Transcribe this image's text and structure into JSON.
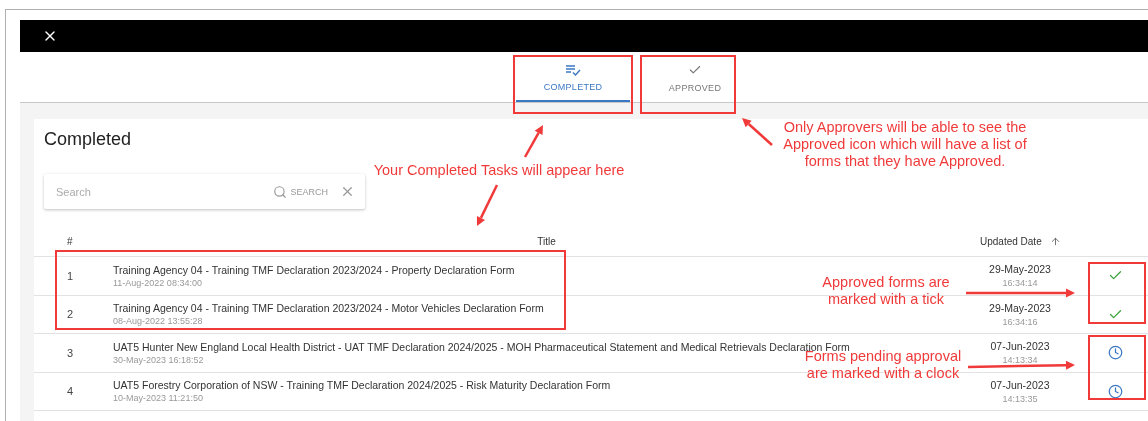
{
  "tabs": [
    {
      "label": "COMPLETED",
      "kind": "list",
      "selected": true
    },
    {
      "label": "APPROVED",
      "kind": "check",
      "selected": false
    }
  ],
  "panel": {
    "title": "Completed",
    "search": {
      "placeholder": "Search",
      "button": "SEARCH"
    }
  },
  "table": {
    "columns": [
      {
        "label": "#",
        "sorted": false
      },
      {
        "label": "Title",
        "sorted": false
      },
      {
        "label": "Updated Date",
        "sorted": true
      }
    ],
    "rows": [
      {
        "number": "1",
        "title": "Training Agency 04 - Training TMF Declaration 2023/2024 - Property Declaration Form",
        "created": "11-Aug-2022 08:34:00",
        "date": "29-May-2023",
        "time": "16:34:14",
        "kind": "approved"
      },
      {
        "number": "2",
        "title": "Training Agency 04 - Training TMF Declaration 2023/2024 - Motor Vehicles Declaration Form",
        "created": "08-Aug-2022 13:55:28",
        "date": "29-May-2023",
        "time": "16:34:16",
        "kind": "approved"
      },
      {
        "number": "3",
        "title": "UAT5 Hunter New England Local Health District - UAT TMF Declaration 2024/2025 - MOH Pharmaceutical Statement and Medical Retrievals Declaration Form",
        "created": "30-May-2023 16:18:52",
        "date": "07-Jun-2023",
        "time": "14:13:34",
        "kind": "pending"
      },
      {
        "number": "4",
        "title": "UAT5 Forestry Corporation of NSW - Training TMF Declaration 2024/2025 - Risk Maturity Declaration Form",
        "created": "10-May-2023 11:21:50",
        "date": "07-Jun-2023",
        "time": "14:13:35",
        "kind": "pending"
      }
    ]
  },
  "annotations": [
    {
      "text": "Your Completed Tasks will appear here"
    },
    {
      "text": "Only Approvers will be able to see the\nApproved icon which will have a list of\nforms that they have Approved."
    },
    {
      "text": "Approved forms are\nmarked with a tick"
    },
    {
      "text": "Forms pending approval\nare marked with a clock"
    }
  ]
}
